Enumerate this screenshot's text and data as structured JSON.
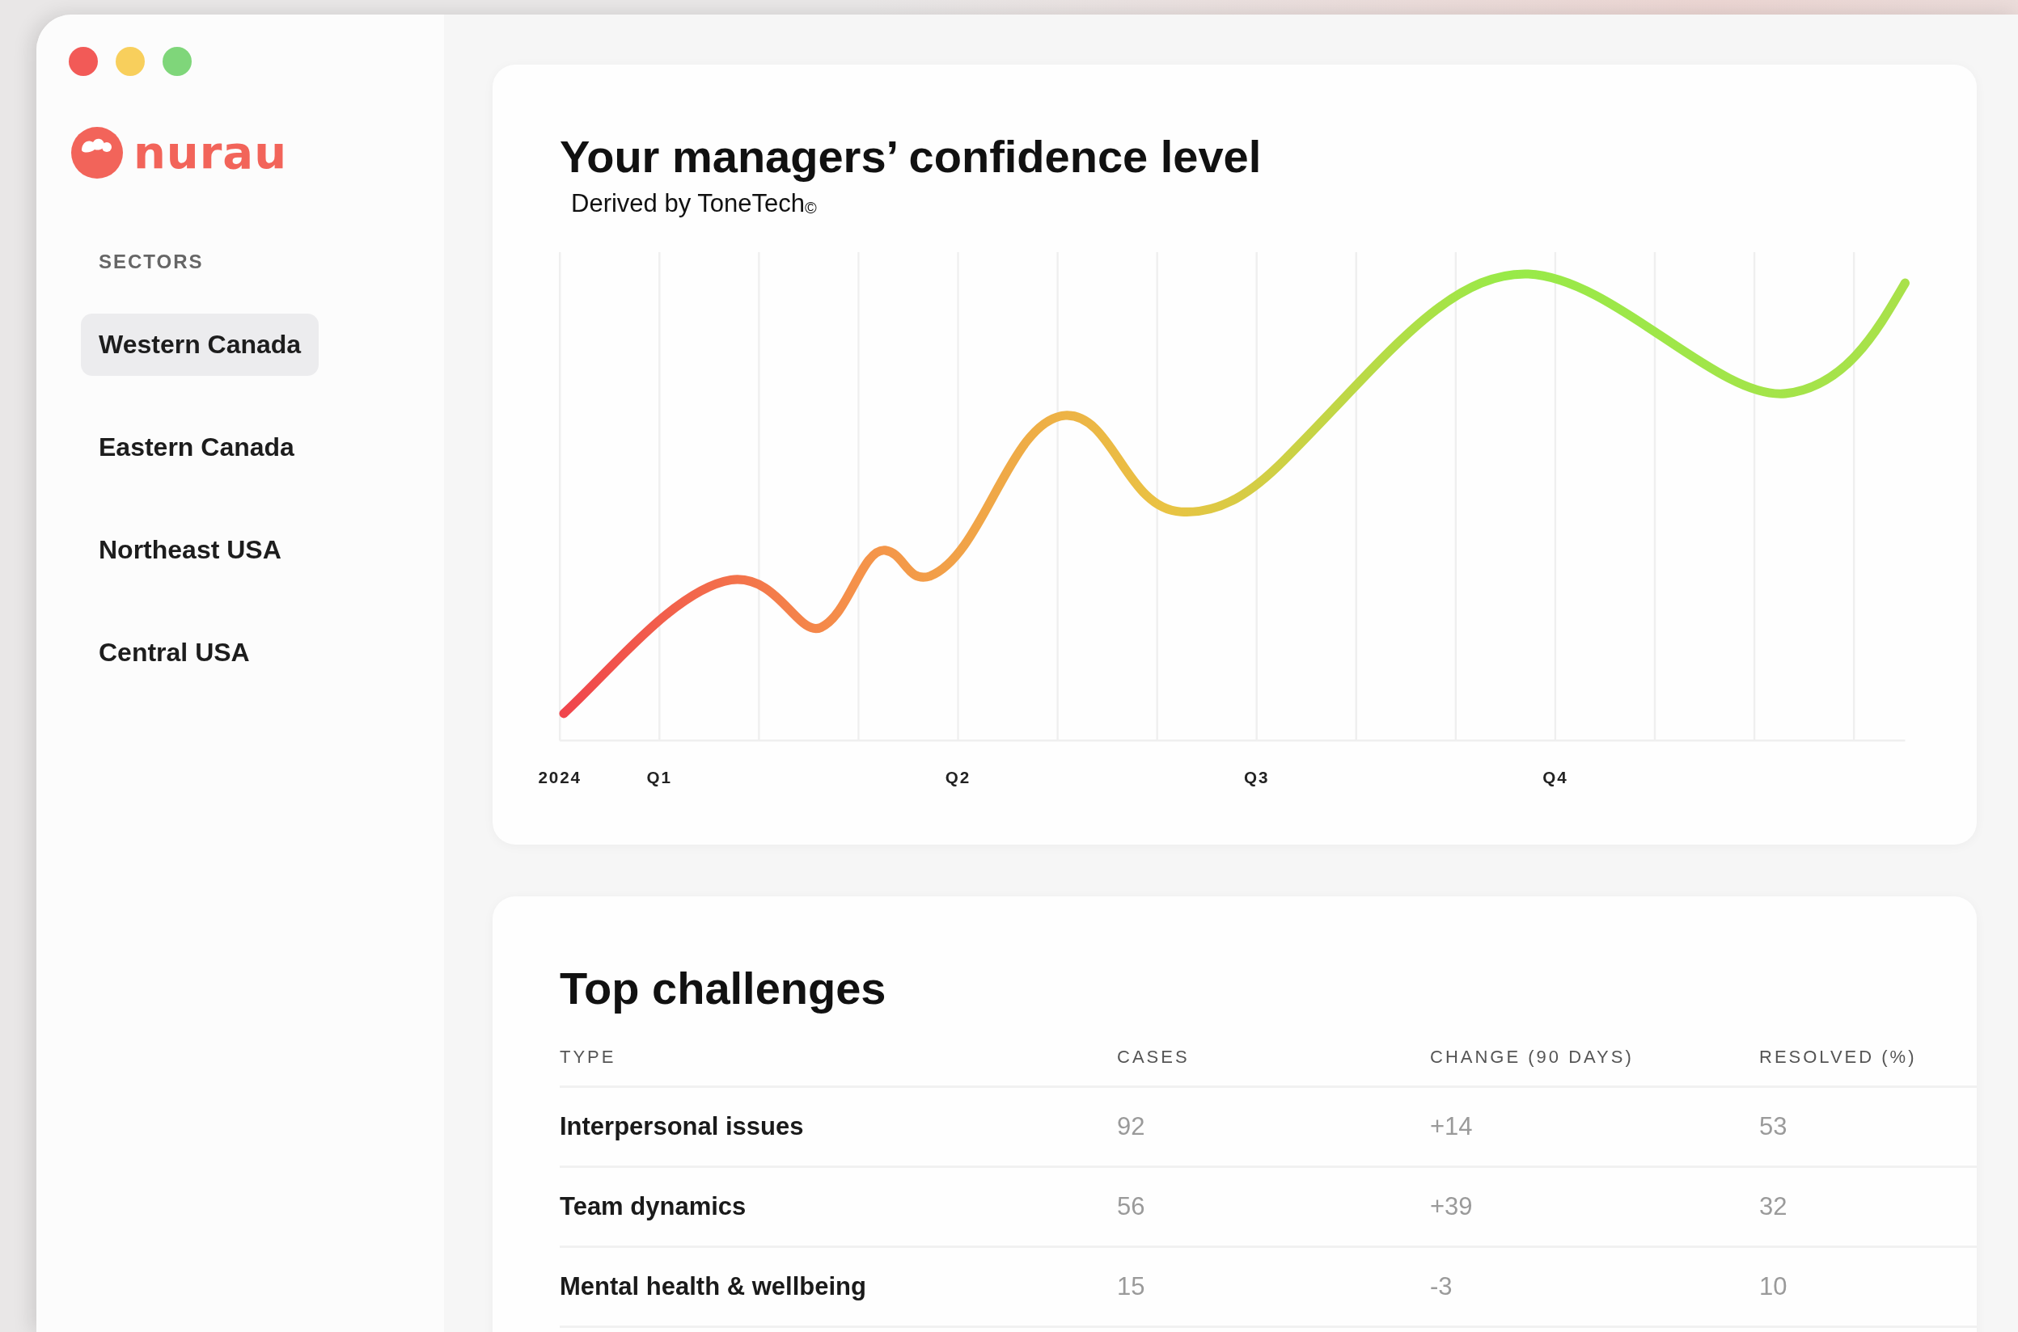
{
  "window": {
    "controls": [
      {
        "color": "#f25a57"
      },
      {
        "color": "#f8cf5c"
      },
      {
        "color": "#7fd67a"
      }
    ]
  },
  "logo": {
    "text": "nurau"
  },
  "sidebar": {
    "heading": "SECTORS",
    "items": [
      {
        "label": "Western Canada",
        "selected": true
      },
      {
        "label": "Eastern Canada",
        "selected": false
      },
      {
        "label": "Northeast USA",
        "selected": false
      },
      {
        "label": "Central USA",
        "selected": false
      }
    ]
  },
  "confidence_chart": {
    "title": "Your managers’ confidence level",
    "subtitle": "Derived by ToneTech$_{©}$",
    "x_labels": [
      "2024",
      "Q1",
      "Q2",
      "Q3",
      "Q4"
    ]
  },
  "challenges": {
    "title": "Top challenges",
    "columns": [
      "TYPE",
      "CASES",
      "CHANGE (90 DAYS)",
      "RESOLVED (%)"
    ],
    "rows": [
      [
        "Interpersonal issues",
        "92",
        "+14",
        "53"
      ],
      [
        "Team dynamics",
        "56",
        "+39",
        "32"
      ],
      [
        "Mental health & wellbeing",
        "15",
        "-3",
        "10"
      ]
    ]
  }
}
